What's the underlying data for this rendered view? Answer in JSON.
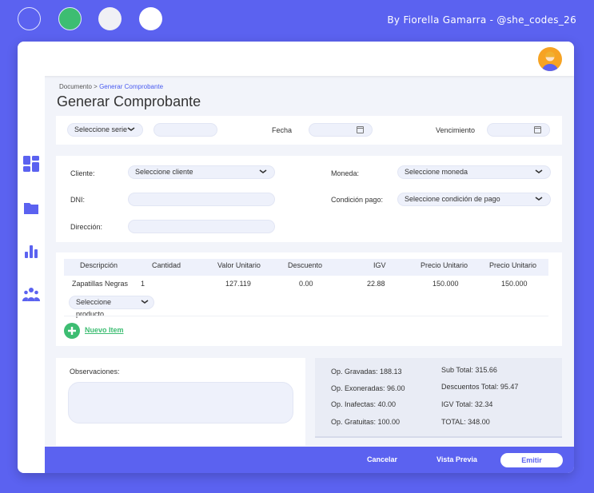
{
  "window": {
    "credit": "By Fiorella Gamarra  -  @she_codes_26",
    "dots": [
      "#5b62f0",
      "#3dbd72",
      "#f0f0f5",
      "#ffffff"
    ]
  },
  "topbar": {
    "avatar_icon": "user-avatar-icon"
  },
  "sidebar": {
    "icons": [
      "dashboard-icon",
      "folder-icon",
      "bar-chart-icon",
      "users-icon"
    ]
  },
  "breadcrumb": {
    "root": "Documento",
    "sep": ">",
    "current": "Generar Comprobante"
  },
  "page": {
    "title": "Generar Comprobante"
  },
  "filters": {
    "serie_label": "Seleccione serie",
    "serie_number": "",
    "fecha_label": "Fecha",
    "fecha_value": "",
    "vencimiento_label": "Vencimiento",
    "vencimiento_value": ""
  },
  "client": {
    "cliente_label": "Cliente:",
    "cliente_value": "Seleccione cliente",
    "dni_label": "DNI:",
    "dni_value": "",
    "direccion_label": "Dirección:",
    "direccion_value": "",
    "moneda_label": "Moneda:",
    "moneda_value": "Seleccione moneda",
    "condicion_label": "Condición pago:",
    "condicion_value": "Seleccione condición de pago"
  },
  "table": {
    "headers": [
      "Descripción",
      "Cantidad",
      "Valor Unitario",
      "Descuento",
      "IGV",
      "Precio Unitario",
      "Precio Unitario"
    ],
    "rows": [
      [
        "Zapatillas Negras",
        "1",
        "127.119",
        "0.00",
        "22.88",
        "150.000",
        "150.000"
      ]
    ],
    "product_select": "Seleccione producto",
    "new_item": "Nuevo Item"
  },
  "observations": {
    "label": "Observaciones:",
    "value": ""
  },
  "totals": {
    "gravadas": "Op. Gravadas:  188.13",
    "exoneradas": "Op. Exoneradas:  96.00",
    "inafectas": "Op. Inafectas:  40.00",
    "gratuitas": "Op. Gratuitas:   100.00",
    "subtotal": "Sub Total:  315.66",
    "descuentos": "Descuentos Total:  95.47",
    "igv": "IGV Total:  32.34",
    "total": "TOTAL:  348.00"
  },
  "footer": {
    "cancel": "Cancelar",
    "preview": "Vista Previa",
    "emit": "Emitir"
  },
  "colors": {
    "accent": "#5b62f0",
    "green": "#3dbd72",
    "avatar": "#f6a323"
  }
}
